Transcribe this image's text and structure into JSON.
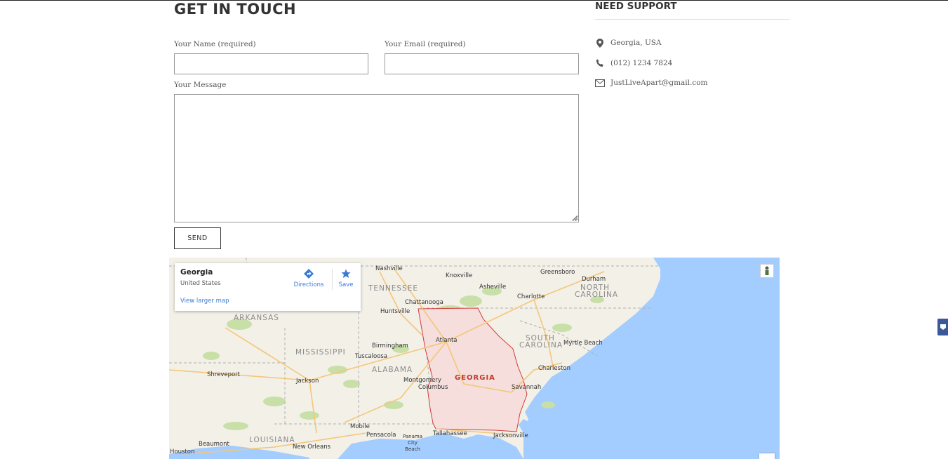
{
  "form": {
    "title": "GET IN TOUCH",
    "name_label": "Your Name (required)",
    "name_value": "",
    "email_label": "Your Email (required)",
    "email_value": "",
    "message_label": "Your Message",
    "message_value": "",
    "send_label": "SEND"
  },
  "support": {
    "title": "NEED SUPPORT",
    "items": [
      {
        "icon": "map-marker-icon",
        "text": "Georgia, USA"
      },
      {
        "icon": "phone-icon",
        "text": "(012) 1234 7824"
      },
      {
        "icon": "envelope-icon",
        "text": "JustLiveApart@gmail.com"
      }
    ]
  },
  "map": {
    "card": {
      "place": "Georgia",
      "region": "United States",
      "directions_label": "Directions",
      "save_label": "Save",
      "larger_map_label": "View larger map"
    },
    "highlight_label": "GEORGIA",
    "states": [
      {
        "name": "TENNESSEE"
      },
      {
        "name": "NORTH"
      },
      {
        "name": "CAROLINA"
      },
      {
        "name": "ARKANSAS"
      },
      {
        "name": "MISSISSIPPI"
      },
      {
        "name": "ALABAMA"
      },
      {
        "name": "SOUTH"
      },
      {
        "name": "CAROLINA"
      },
      {
        "name": "LOUISIANA"
      }
    ],
    "cities": [
      {
        "name": "Nashville"
      },
      {
        "name": "Knoxville"
      },
      {
        "name": "Greensboro"
      },
      {
        "name": "Durham"
      },
      {
        "name": "Asheville"
      },
      {
        "name": "Charlotte"
      },
      {
        "name": "Chattanooga"
      },
      {
        "name": "Huntsville"
      },
      {
        "name": "Atlanta"
      },
      {
        "name": "Birmingham"
      },
      {
        "name": "Tuscaloosa"
      },
      {
        "name": "Myrtle Beach"
      },
      {
        "name": "Charleston"
      },
      {
        "name": "Shreveport"
      },
      {
        "name": "Jackson"
      },
      {
        "name": "Montgomery"
      },
      {
        "name": "Columbus"
      },
      {
        "name": "Savannah"
      },
      {
        "name": "Mobile"
      },
      {
        "name": "Pensacola"
      },
      {
        "name": "Panama City Beach"
      },
      {
        "name": "Tallahassee"
      },
      {
        "name": "Jacksonville"
      },
      {
        "name": "Beaumont"
      },
      {
        "name": "New Orleans"
      },
      {
        "name": "Houston"
      }
    ]
  },
  "colors": {
    "ocean": "#a3ccff",
    "land": "#f3f0e8",
    "park": "#c8e0a8",
    "highlight_fill": "#f5dedb",
    "highlight_border": "#d23c3c",
    "link_blue": "#3a7bd5",
    "side_tab": "#3b5998"
  }
}
